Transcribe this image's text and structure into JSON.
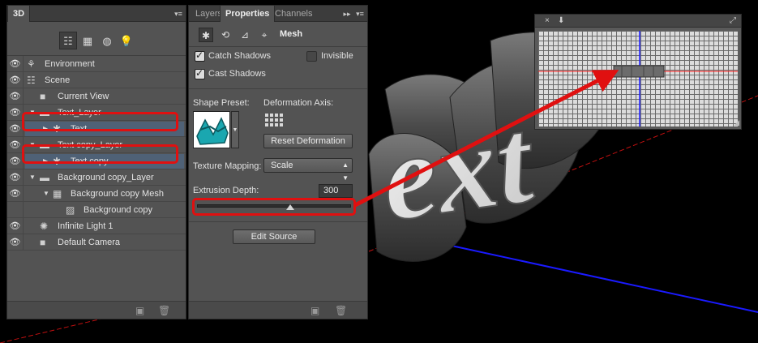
{
  "panel3d": {
    "tab_label": "3D",
    "filter_icons": [
      "scene-filter-icon",
      "mesh-filter-icon",
      "material-filter-icon",
      "light-filter-icon"
    ],
    "tree": [
      {
        "label": "Environment",
        "visible": true
      },
      {
        "label": "Scene",
        "visible": true
      },
      {
        "label": "Current View",
        "visible": true
      },
      {
        "label": "Text_Layer",
        "visible": true
      },
      {
        "label": "Text",
        "visible": true,
        "selected": true
      },
      {
        "label": "Text copy_Layer",
        "visible": true
      },
      {
        "label": "Text copy",
        "visible": true,
        "selected": true
      },
      {
        "label": "Background copy_Layer",
        "visible": true
      },
      {
        "label": "Background copy Mesh",
        "visible": true
      },
      {
        "label": "Background copy",
        "visible": false
      },
      {
        "label": "Infinite Light 1",
        "visible": true
      },
      {
        "label": "Default Camera",
        "visible": true
      }
    ]
  },
  "properties": {
    "tabs": [
      "Layers",
      "Properties",
      "Channels"
    ],
    "active_tab": "Properties",
    "section_title": "Mesh",
    "catch_shadows_label": "Catch Shadows",
    "catch_shadows": true,
    "invisible_label": "Invisible",
    "invisible": false,
    "cast_shadows_label": "Cast Shadows",
    "cast_shadows": true,
    "shape_preset_label": "Shape Preset:",
    "deformation_axis_label": "Deformation Axis:",
    "reset_deformation_label": "Reset Deformation",
    "texture_mapping_label": "Texture Mapping:",
    "texture_mapping_value": "Scale",
    "extrusion_depth_label": "Extrusion Depth:",
    "extrusion_depth_value": "300",
    "edit_source_label": "Edit Source"
  },
  "texture_window": {
    "close_glyph": "×",
    "dock_glyph": "⬇"
  },
  "scene_text": "ext",
  "colors": {
    "annotation_red": "#e01010",
    "panel_bg": "#535353",
    "selection_blue": "#4f6176",
    "axis_blue": "#1a1aff",
    "axis_red": "#d01010"
  }
}
